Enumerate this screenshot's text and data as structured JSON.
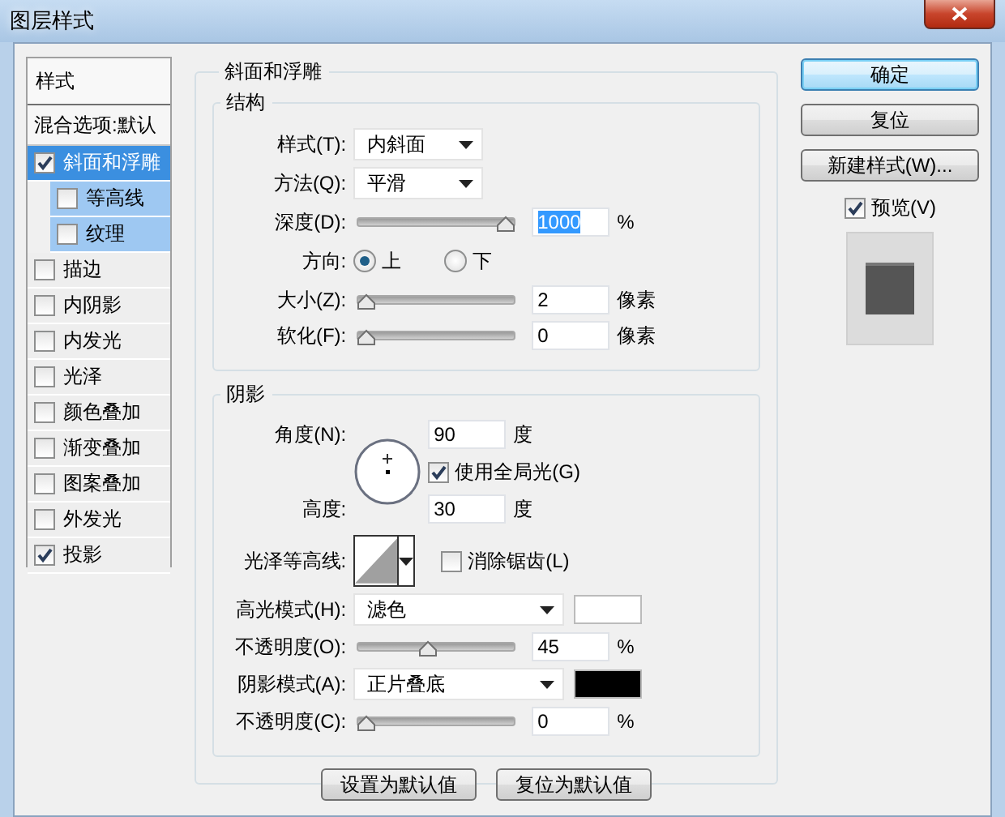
{
  "window": {
    "title": "图层样式"
  },
  "sidebar": {
    "title": "样式",
    "items": [
      {
        "label": "混合选项:默认",
        "kind": "plain",
        "selected": false
      },
      {
        "label": "斜面和浮雕",
        "kind": "check",
        "checked": true,
        "selected": true,
        "children": [
          {
            "label": "等高线",
            "checked": false,
            "selected": false
          },
          {
            "label": "纹理",
            "checked": false,
            "selected": false
          }
        ]
      },
      {
        "label": "描边",
        "kind": "check",
        "checked": false,
        "selected": false
      },
      {
        "label": "内阴影",
        "kind": "check",
        "checked": false,
        "selected": false
      },
      {
        "label": "内发光",
        "kind": "check",
        "checked": false,
        "selected": false
      },
      {
        "label": "光泽",
        "kind": "check",
        "checked": false,
        "selected": false
      },
      {
        "label": "颜色叠加",
        "kind": "check",
        "checked": false,
        "selected": false
      },
      {
        "label": "渐变叠加",
        "kind": "check",
        "checked": false,
        "selected": false
      },
      {
        "label": "图案叠加",
        "kind": "check",
        "checked": false,
        "selected": false
      },
      {
        "label": "外发光",
        "kind": "check",
        "checked": false,
        "selected": false
      },
      {
        "label": "投影",
        "kind": "check",
        "checked": true,
        "selected": false
      }
    ]
  },
  "bevel": {
    "title": "斜面和浮雕",
    "structure": {
      "title": "结构",
      "rows": [
        {
          "kind": "select",
          "label": "样式(T):",
          "value": "内斜面"
        },
        {
          "kind": "select",
          "label": "方法(Q):",
          "value": "平滑"
        },
        {
          "kind": "slider",
          "label": "深度(D):",
          "level": 1.0,
          "value": "1000",
          "unit": "%",
          "text_selected": true
        },
        {
          "kind": "radio",
          "label": "方向:",
          "options": [
            {
              "label": "上",
              "selected": true
            },
            {
              "label": "下",
              "selected": false
            }
          ]
        },
        {
          "kind": "slider",
          "label": "大小(Z):",
          "level": 0.0,
          "value": "2",
          "unit": "像素",
          "text_selected": false
        },
        {
          "kind": "slider",
          "label": "软化(F):",
          "level": 0.0,
          "value": "0",
          "unit": "像素",
          "text_selected": false
        }
      ]
    },
    "shading": {
      "title": "阴影",
      "angle": {
        "label": "角度(N):",
        "value": "90",
        "unit": "度"
      },
      "global_light": {
        "label": "使用全局光(G)",
        "checked": true
      },
      "altitude": {
        "label": "高度:",
        "value": "30",
        "unit": "度"
      },
      "gloss_contour": {
        "label": "光泽等高线:"
      },
      "anti_alias": {
        "label": "消除锯齿(L)",
        "checked": false
      },
      "rows": [
        {
          "kind": "select",
          "label": "高光模式(H):",
          "value": "滤色",
          "color": "#ffffff"
        },
        {
          "kind": "slider",
          "label": "不透明度(O):",
          "level": 0.45,
          "value": "45",
          "unit": "%",
          "text_selected": false
        },
        {
          "kind": "select",
          "label": "阴影模式(A):",
          "value": "正片叠底",
          "color": "#000000"
        },
        {
          "kind": "slider",
          "label": "不透明度(C):",
          "level": 0.0,
          "value": "0",
          "unit": "%",
          "text_selected": false
        }
      ]
    },
    "buttons": [
      "设置为默认值",
      "复位为默认值"
    ]
  },
  "actions": {
    "buttons": [
      {
        "label": "确定",
        "default": true
      },
      {
        "label": "复位",
        "default": false
      },
      {
        "label": "新建样式(W)...",
        "default": false
      }
    ],
    "preview": {
      "label": "预览(V)",
      "checked": true
    }
  }
}
